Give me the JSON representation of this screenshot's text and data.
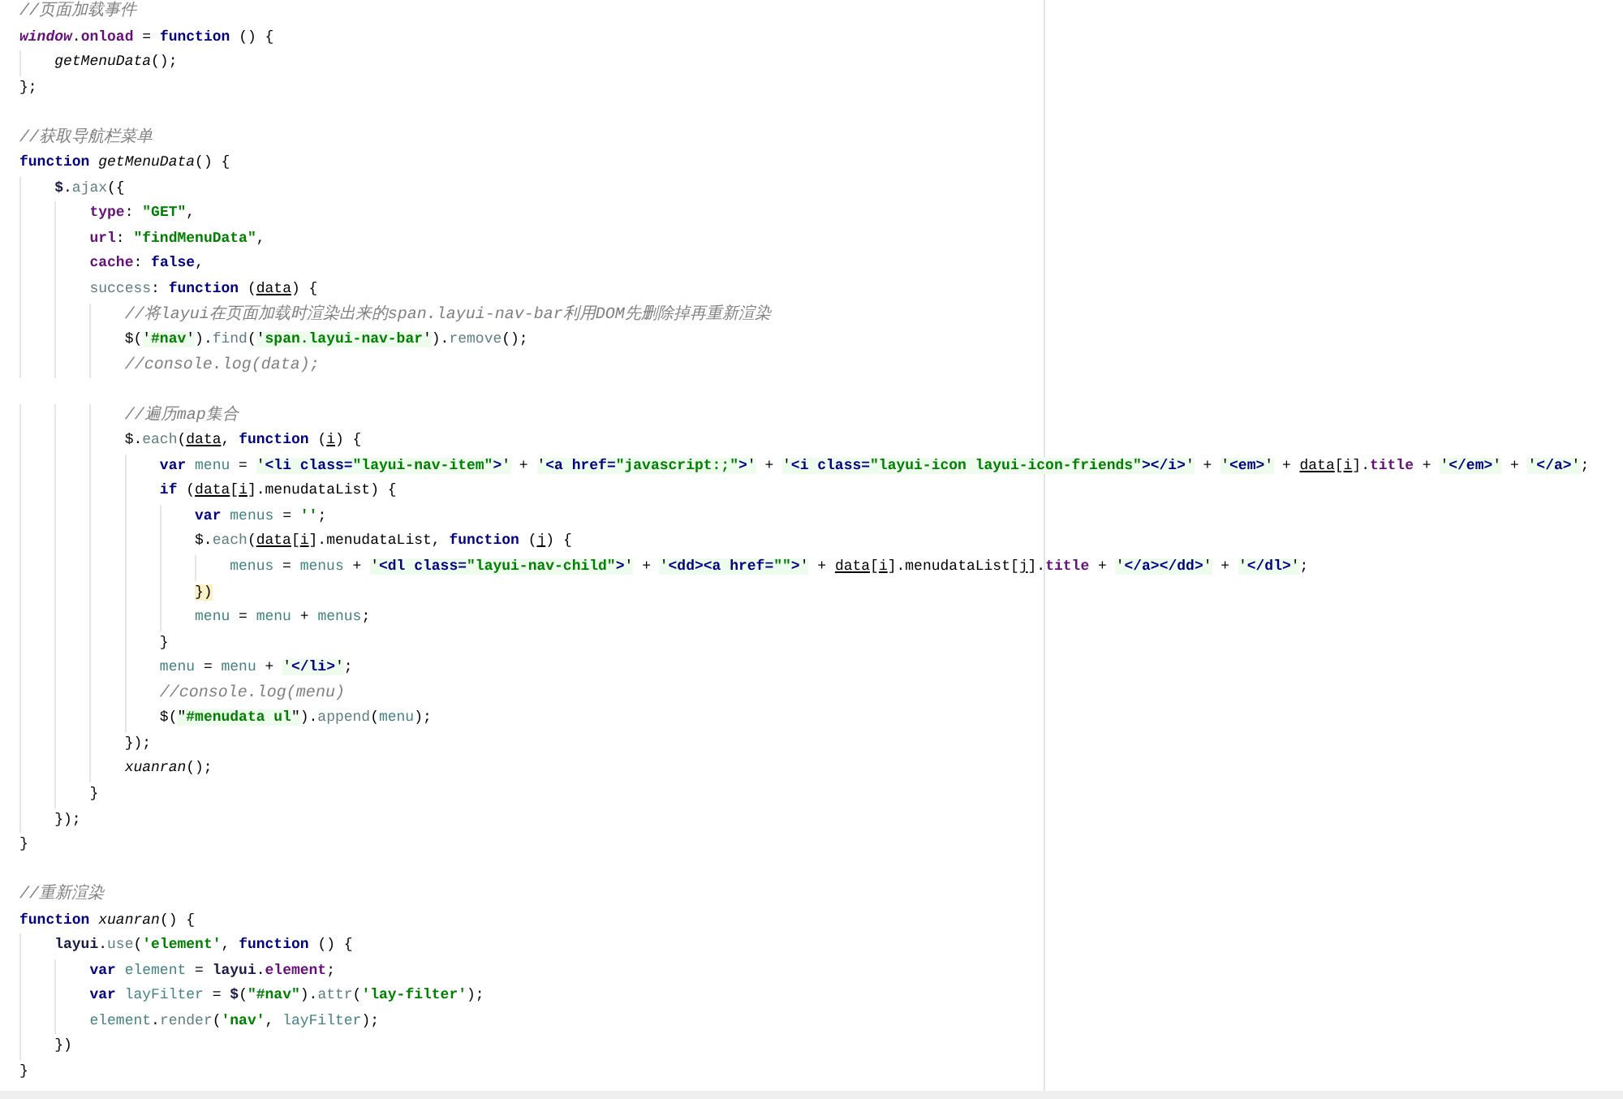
{
  "editor": {
    "lines": [
      {
        "tokens": [
          {
            "kind": "comment",
            "text": "//页面加载事件"
          }
        ]
      },
      {
        "tokens": [
          {
            "kind": "global",
            "text": "window"
          },
          {
            "kind": "plain",
            "text": "."
          },
          {
            "kind": "prop",
            "text": "onload"
          },
          {
            "kind": "plain",
            "text": " = "
          },
          {
            "kind": "keyword",
            "text": "function"
          },
          {
            "kind": "plain",
            "text": " () {"
          }
        ]
      },
      {
        "tokens": [
          {
            "kind": "call",
            "text": "    getMenuData"
          },
          {
            "kind": "plain",
            "text": "();"
          }
        ]
      },
      {
        "tokens": [
          {
            "kind": "plain",
            "text": "};"
          }
        ]
      },
      {
        "kind": "blank"
      },
      {
        "tokens": [
          {
            "kind": "comment",
            "text": "//获取导航栏菜单"
          }
        ]
      },
      {
        "tokens": [
          {
            "kind": "keyword",
            "text": "function"
          },
          {
            "kind": "call",
            "text": " getMenuData"
          },
          {
            "kind": "plain",
            "text": "() {"
          }
        ]
      },
      {
        "tokens": [
          {
            "kind": "bold",
            "text": "    $"
          },
          {
            "kind": "plain",
            "text": "."
          },
          {
            "kind": "method",
            "text": "ajax"
          },
          {
            "kind": "plain",
            "text": "({"
          }
        ]
      },
      {
        "tokens": [
          {
            "kind": "prop",
            "text": "        type"
          },
          {
            "kind": "plain",
            "text": ": "
          },
          {
            "kind": "string",
            "text": "\"GET\""
          },
          {
            "kind": "plain",
            "text": ","
          }
        ]
      },
      {
        "tokens": [
          {
            "kind": "prop",
            "text": "        url"
          },
          {
            "kind": "plain",
            "text": ": "
          },
          {
            "kind": "string",
            "text": "\"findMenuData\""
          },
          {
            "kind": "plain",
            "text": ","
          }
        ]
      },
      {
        "tokens": [
          {
            "kind": "prop",
            "text": "        cache"
          },
          {
            "kind": "plain",
            "text": ": "
          },
          {
            "kind": "keyword",
            "text": "false"
          },
          {
            "kind": "plain",
            "text": ","
          }
        ]
      },
      {
        "tokens": [
          {
            "kind": "method",
            "text": "        success"
          },
          {
            "kind": "plain",
            "text": ": "
          },
          {
            "kind": "keyword",
            "text": "function"
          },
          {
            "kind": "plain",
            "text": " ("
          },
          {
            "kind": "param",
            "text": "data"
          },
          {
            "kind": "plain",
            "text": ") {"
          }
        ]
      },
      {
        "tokens": [
          {
            "kind": "comment",
            "text": "            //将layui在页面加载时渲染出来的span.layui-nav-bar利用DOM先删除掉再重新渲染"
          }
        ]
      },
      {
        "tokens": [
          {
            "kind": "plain",
            "text": "            $("
          },
          {
            "kind": "hs",
            "text": "'"
          },
          {
            "kind": "val",
            "text": "#nav"
          },
          {
            "kind": "hs",
            "text": "'"
          },
          {
            "kind": "plain",
            "text": ")."
          },
          {
            "kind": "method",
            "text": "find"
          },
          {
            "kind": "plain",
            "text": "("
          },
          {
            "kind": "hs",
            "text": "'"
          },
          {
            "kind": "val",
            "text": "span.layui-nav-bar"
          },
          {
            "kind": "hs",
            "text": "'"
          },
          {
            "kind": "plain",
            "text": ")."
          },
          {
            "kind": "method",
            "text": "remove"
          },
          {
            "kind": "plain",
            "text": "();"
          }
        ]
      },
      {
        "tokens": [
          {
            "kind": "comment",
            "text": "            //console.log(data);"
          }
        ]
      },
      {
        "kind": "blank"
      },
      {
        "tokens": [
          {
            "kind": "comment",
            "text": "            //遍历map集合"
          }
        ]
      },
      {
        "tokens": [
          {
            "kind": "plain",
            "text": "            $."
          },
          {
            "kind": "method",
            "text": "each"
          },
          {
            "kind": "plain",
            "text": "("
          },
          {
            "kind": "param",
            "text": "data"
          },
          {
            "kind": "plain",
            "text": ", "
          },
          {
            "kind": "keyword",
            "text": "function"
          },
          {
            "kind": "plain",
            "text": " ("
          },
          {
            "kind": "param",
            "text": "i"
          },
          {
            "kind": "plain",
            "text": ") {"
          }
        ]
      },
      {
        "tokens": [
          {
            "kind": "keyword",
            "text": "                var"
          },
          {
            "kind": "local",
            "text": " menu"
          },
          {
            "kind": "plain",
            "text": " = "
          },
          {
            "kind": "hs",
            "text": "'"
          },
          {
            "kind": "tag",
            "text": "<li class="
          },
          {
            "kind": "val",
            "text": "\"layui-nav-item\""
          },
          {
            "kind": "tag",
            "text": ">"
          },
          {
            "kind": "hs",
            "text": "'"
          },
          {
            "kind": "plain",
            "text": " + "
          },
          {
            "kind": "hs",
            "text": "'"
          },
          {
            "kind": "tag",
            "text": "<a href="
          },
          {
            "kind": "val",
            "text": "\"javascript:;\""
          },
          {
            "kind": "tag",
            "text": ">"
          },
          {
            "kind": "hs",
            "text": "'"
          },
          {
            "kind": "plain",
            "text": " + "
          },
          {
            "kind": "hs",
            "text": "'"
          },
          {
            "kind": "tag",
            "text": "<i class="
          },
          {
            "kind": "val",
            "text": "\"layui-icon layui-icon-friends\""
          },
          {
            "kind": "tag",
            "text": "></i>"
          },
          {
            "kind": "hs",
            "text": "'"
          },
          {
            "kind": "plain",
            "text": " + "
          },
          {
            "kind": "hs",
            "text": "'"
          },
          {
            "kind": "tag",
            "text": "<em>"
          },
          {
            "kind": "hs",
            "text": "'"
          },
          {
            "kind": "plain",
            "text": " + "
          },
          {
            "kind": "param",
            "text": "data"
          },
          {
            "kind": "plain",
            "text": "["
          },
          {
            "kind": "param",
            "text": "i"
          },
          {
            "kind": "plain",
            "text": "]."
          },
          {
            "kind": "prop",
            "text": "title"
          },
          {
            "kind": "plain",
            "text": " + "
          },
          {
            "kind": "hs",
            "text": "'"
          },
          {
            "kind": "tag",
            "text": "</em>"
          },
          {
            "kind": "hs",
            "text": "'"
          },
          {
            "kind": "plain",
            "text": " + "
          },
          {
            "kind": "hs",
            "text": "'"
          },
          {
            "kind": "tag",
            "text": "</a>"
          },
          {
            "kind": "hs",
            "text": "'"
          },
          {
            "kind": "plain",
            "text": ";"
          }
        ]
      },
      {
        "tokens": [
          {
            "kind": "keyword",
            "text": "                if"
          },
          {
            "kind": "plain",
            "text": " ("
          },
          {
            "kind": "param",
            "text": "data"
          },
          {
            "kind": "plain",
            "text": "["
          },
          {
            "kind": "param",
            "text": "i"
          },
          {
            "kind": "plain",
            "text": "].menudataList) {"
          }
        ]
      },
      {
        "tokens": [
          {
            "kind": "keyword",
            "text": "                    var"
          },
          {
            "kind": "local",
            "text": " menus"
          },
          {
            "kind": "plain",
            "text": " = "
          },
          {
            "kind": "string",
            "text": "''"
          },
          {
            "kind": "plain",
            "text": ";"
          }
        ]
      },
      {
        "tokens": [
          {
            "kind": "plain",
            "text": "                    $."
          },
          {
            "kind": "method",
            "text": "each"
          },
          {
            "kind": "plain",
            "text": "("
          },
          {
            "kind": "param",
            "text": "data"
          },
          {
            "kind": "plain",
            "text": "["
          },
          {
            "kind": "param",
            "text": "i"
          },
          {
            "kind": "plain",
            "text": "].menudataList, "
          },
          {
            "kind": "keyword",
            "text": "function"
          },
          {
            "kind": "plain",
            "text": " ("
          },
          {
            "kind": "param",
            "text": "j"
          },
          {
            "kind": "plain",
            "text": ") {"
          }
        ]
      },
      {
        "tokens": [
          {
            "kind": "local",
            "text": "                        menus"
          },
          {
            "kind": "plain",
            "text": " = "
          },
          {
            "kind": "local",
            "text": "menus"
          },
          {
            "kind": "plain",
            "text": " + "
          },
          {
            "kind": "hs",
            "text": "'"
          },
          {
            "kind": "tag",
            "text": "<dl class="
          },
          {
            "kind": "val",
            "text": "\"layui-nav-child\""
          },
          {
            "kind": "tag",
            "text": ">"
          },
          {
            "kind": "hs",
            "text": "'"
          },
          {
            "kind": "plain",
            "text": " + "
          },
          {
            "kind": "hs",
            "text": "'"
          },
          {
            "kind": "tag",
            "text": "<dd><a href="
          },
          {
            "kind": "val",
            "text": "\"\""
          },
          {
            "kind": "tag",
            "text": ">"
          },
          {
            "kind": "hs",
            "text": "'"
          },
          {
            "kind": "plain",
            "text": " + "
          },
          {
            "kind": "param",
            "text": "data"
          },
          {
            "kind": "plain",
            "text": "["
          },
          {
            "kind": "param",
            "text": "i"
          },
          {
            "kind": "plain",
            "text": "].menudataList["
          },
          {
            "kind": "param",
            "text": "j"
          },
          {
            "kind": "plain",
            "text": "]."
          },
          {
            "kind": "prop",
            "text": "title"
          },
          {
            "kind": "plain",
            "text": " + "
          },
          {
            "kind": "hs",
            "text": "'"
          },
          {
            "kind": "tag",
            "text": "</a></dd>"
          },
          {
            "kind": "hs",
            "text": "'"
          },
          {
            "kind": "plain",
            "text": " + "
          },
          {
            "kind": "hs",
            "text": "'"
          },
          {
            "kind": "tag",
            "text": "</dl>"
          },
          {
            "kind": "hs",
            "text": "'"
          },
          {
            "kind": "plain",
            "text": ";"
          }
        ]
      },
      {
        "tokens": [
          {
            "kind": "match",
            "text": "                    })"
          }
        ]
      },
      {
        "tokens": [
          {
            "kind": "local",
            "text": "                    menu"
          },
          {
            "kind": "plain",
            "text": " = "
          },
          {
            "kind": "local",
            "text": "menu"
          },
          {
            "kind": "plain",
            "text": " + "
          },
          {
            "kind": "local",
            "text": "menus"
          },
          {
            "kind": "plain",
            "text": ";"
          }
        ]
      },
      {
        "tokens": [
          {
            "kind": "plain",
            "text": "                }"
          }
        ]
      },
      {
        "tokens": [
          {
            "kind": "local",
            "text": "                menu"
          },
          {
            "kind": "plain",
            "text": " = "
          },
          {
            "kind": "local",
            "text": "menu"
          },
          {
            "kind": "plain",
            "text": " + "
          },
          {
            "kind": "hs",
            "text": "'"
          },
          {
            "kind": "tag",
            "text": "</li>"
          },
          {
            "kind": "hs",
            "text": "'"
          },
          {
            "kind": "plain",
            "text": ";"
          }
        ]
      },
      {
        "tokens": [
          {
            "kind": "comment",
            "text": "                //console.log(menu)"
          }
        ]
      },
      {
        "tokens": [
          {
            "kind": "plain",
            "text": "                $("
          },
          {
            "kind": "hs",
            "text": "\""
          },
          {
            "kind": "val",
            "text": "#menudata ul"
          },
          {
            "kind": "hs",
            "text": "\""
          },
          {
            "kind": "plain",
            "text": ")."
          },
          {
            "kind": "method",
            "text": "append"
          },
          {
            "kind": "plain",
            "text": "("
          },
          {
            "kind": "local",
            "text": "menu"
          },
          {
            "kind": "plain",
            "text": ");"
          }
        ]
      },
      {
        "tokens": [
          {
            "kind": "plain",
            "text": "            });"
          }
        ]
      },
      {
        "tokens": [
          {
            "kind": "call",
            "text": "            xuanran"
          },
          {
            "kind": "plain",
            "text": "();"
          }
        ]
      },
      {
        "tokens": [
          {
            "kind": "plain",
            "text": "        }"
          }
        ]
      },
      {
        "tokens": [
          {
            "kind": "plain",
            "text": "    });"
          }
        ]
      },
      {
        "tokens": [
          {
            "kind": "plain",
            "text": "}"
          }
        ]
      },
      {
        "kind": "blank"
      },
      {
        "tokens": [
          {
            "kind": "comment",
            "text": "//重新渲染"
          }
        ]
      },
      {
        "tokens": [
          {
            "kind": "keyword",
            "text": "function"
          },
          {
            "kind": "call",
            "text": " xuanran"
          },
          {
            "kind": "plain",
            "text": "() {"
          }
        ]
      },
      {
        "tokens": [
          {
            "kind": "bold",
            "text": "    layui"
          },
          {
            "kind": "plain",
            "text": "."
          },
          {
            "kind": "method",
            "text": "use"
          },
          {
            "kind": "plain",
            "text": "("
          },
          {
            "kind": "string",
            "text": "'element'"
          },
          {
            "kind": "plain",
            "text": ", "
          },
          {
            "kind": "keyword",
            "text": "function"
          },
          {
            "kind": "plain",
            "text": " () {"
          }
        ]
      },
      {
        "tokens": [
          {
            "kind": "keyword",
            "text": "        var"
          },
          {
            "kind": "local",
            "text": " element"
          },
          {
            "kind": "plain",
            "text": " = "
          },
          {
            "kind": "bold",
            "text": "layui"
          },
          {
            "kind": "plain",
            "text": "."
          },
          {
            "kind": "prop",
            "text": "element"
          },
          {
            "kind": "plain",
            "text": ";"
          }
        ]
      },
      {
        "tokens": [
          {
            "kind": "keyword",
            "text": "        var"
          },
          {
            "kind": "local",
            "text": " layFilter"
          },
          {
            "kind": "plain",
            "text": " = "
          },
          {
            "kind": "bold",
            "text": "$"
          },
          {
            "kind": "plain",
            "text": "("
          },
          {
            "kind": "string",
            "text": "\"#nav\""
          },
          {
            "kind": "plain",
            "text": ")."
          },
          {
            "kind": "method",
            "text": "attr"
          },
          {
            "kind": "plain",
            "text": "("
          },
          {
            "kind": "string",
            "text": "'lay-filter'"
          },
          {
            "kind": "plain",
            "text": ");"
          }
        ]
      },
      {
        "tokens": [
          {
            "kind": "local",
            "text": "        element"
          },
          {
            "kind": "plain",
            "text": "."
          },
          {
            "kind": "method",
            "text": "render"
          },
          {
            "kind": "plain",
            "text": "("
          },
          {
            "kind": "string",
            "text": "'nav'"
          },
          {
            "kind": "plain",
            "text": ", "
          },
          {
            "kind": "local",
            "text": "layFilter"
          },
          {
            "kind": "plain",
            "text": ");"
          }
        ]
      },
      {
        "tokens": [
          {
            "kind": "plain",
            "text": "    })"
          }
        ]
      },
      {
        "tokens": [
          {
            "kind": "plain",
            "text": "}"
          }
        ]
      }
    ]
  }
}
